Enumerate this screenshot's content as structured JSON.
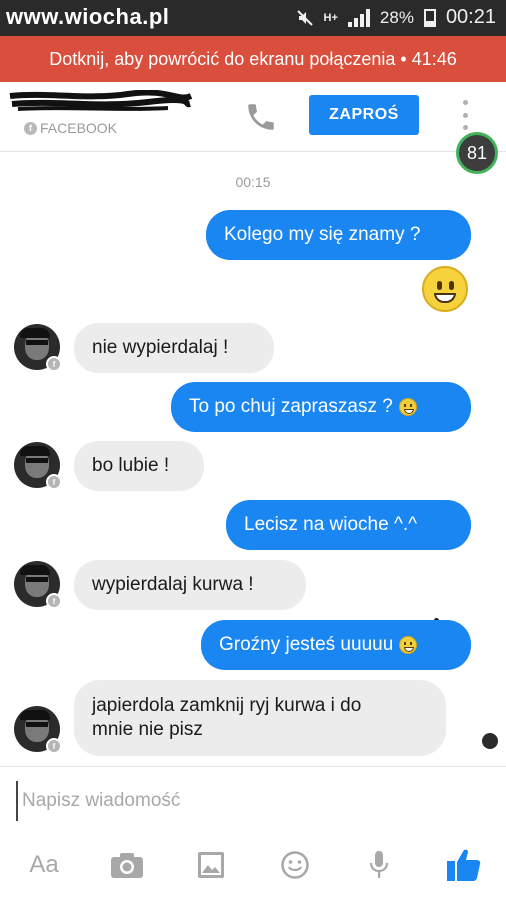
{
  "watermark": "www.wiocha.pl",
  "status_bar": {
    "network": "H+",
    "battery": "28%",
    "time": "00:21"
  },
  "call_banner": {
    "text": "Dotknij, aby powrócić do ekranu połączenia • 41:46"
  },
  "header": {
    "source_label": "FACEBOOK",
    "invite_label": "ZAPROŚ",
    "badge_count": "81",
    "call_icon": "phone-icon",
    "menu_icon": "kebab-menu-icon"
  },
  "chat": {
    "timestamp": "00:15",
    "messages": [
      {
        "from": "me",
        "text": "Kolego my się znamy ?"
      },
      {
        "from": "me",
        "emoji": "grinning-face"
      },
      {
        "from": "them",
        "text": "nie wypierdalaj !"
      },
      {
        "from": "me",
        "text": "To po chuj zapraszasz ?"
      },
      {
        "from": "them",
        "text": "bo lubie !"
      },
      {
        "from": "me",
        "text": "Lecisz na wioche ^.^"
      },
      {
        "from": "them",
        "text": "wypierdalaj kurwa !"
      },
      {
        "from": "me",
        "text": "Groźny jesteś uuuuu"
      },
      {
        "from": "them",
        "text_line1": "japierdola zamknij ryj kurwa i do",
        "text_line2": "mnie nie pisz"
      }
    ]
  },
  "composer": {
    "placeholder": "Napisz wiadomość",
    "aa_label": "Aa",
    "icons": [
      "camera-icon",
      "gallery-icon",
      "emoji-icon",
      "microphone-icon",
      "thumbs-up-icon"
    ]
  },
  "colors": {
    "accent": "#1a86f2",
    "call_banner": "#d94e3c",
    "incoming_bubble": "#ececec",
    "badge_ring": "#43b35b"
  }
}
